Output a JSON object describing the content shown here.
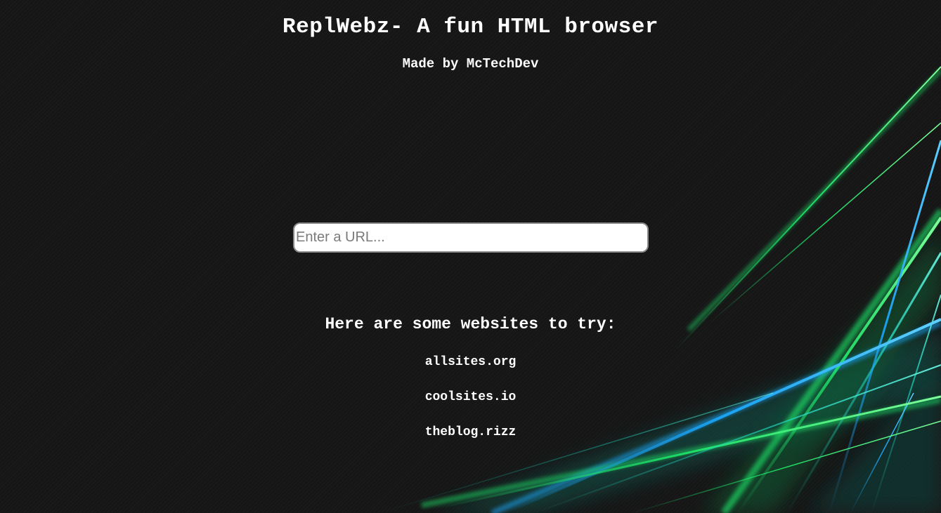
{
  "header": {
    "title": "ReplWebz- A fun HTML browser",
    "subtitle": "Made by McTechDev"
  },
  "search": {
    "placeholder": "Enter a URL...",
    "value": ""
  },
  "sites": {
    "heading": "Here are some websites to try:",
    "items": [
      {
        "label": "allsites.org"
      },
      {
        "label": "coolsites.io"
      },
      {
        "label": "theblog.rizz"
      }
    ]
  },
  "theme": {
    "background": "#161616",
    "text": "#ffffff",
    "accent_green": "#1fe86a",
    "accent_blue": "#1aa9ff",
    "accent_teal": "#1fd8c0"
  }
}
